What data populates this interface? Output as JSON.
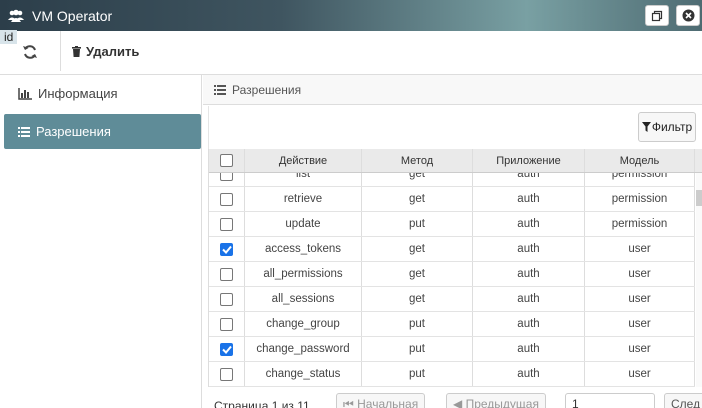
{
  "window": {
    "title": "VM Operator",
    "id_tag": "id"
  },
  "toolbar": {
    "delete_label": "Удалить"
  },
  "sidebar": {
    "items": [
      {
        "label": "Информация",
        "icon": "bar-chart-icon",
        "active": false
      },
      {
        "label": "Разрешения",
        "icon": "list-icon",
        "active": true
      }
    ]
  },
  "panel": {
    "title": "Разрешения"
  },
  "filter": {
    "label": "Фильтр"
  },
  "table": {
    "headers": [
      "Действие",
      "Метод",
      "Приложение",
      "Модель"
    ],
    "rows": [
      {
        "checked": false,
        "action": "list",
        "method": "get",
        "app": "auth",
        "model": "permission"
      },
      {
        "checked": false,
        "action": "retrieve",
        "method": "get",
        "app": "auth",
        "model": "permission"
      },
      {
        "checked": false,
        "action": "update",
        "method": "put",
        "app": "auth",
        "model": "permission"
      },
      {
        "checked": true,
        "action": "access_tokens",
        "method": "get",
        "app": "auth",
        "model": "user"
      },
      {
        "checked": false,
        "action": "all_permissions",
        "method": "get",
        "app": "auth",
        "model": "user"
      },
      {
        "checked": false,
        "action": "all_sessions",
        "method": "get",
        "app": "auth",
        "model": "user"
      },
      {
        "checked": false,
        "action": "change_group",
        "method": "put",
        "app": "auth",
        "model": "user"
      },
      {
        "checked": true,
        "action": "change_password",
        "method": "put",
        "app": "auth",
        "model": "user"
      },
      {
        "checked": false,
        "action": "change_status",
        "method": "put",
        "app": "auth",
        "model": "user"
      }
    ]
  },
  "pager": {
    "page_text": "Страница 1 из 11",
    "first_label": "Начальная",
    "prev_label": "Предыдущая",
    "page_select": "1",
    "next_label": "След"
  },
  "colors": {
    "accent": "#5f8c98",
    "checkbox": "#1a73e8"
  }
}
